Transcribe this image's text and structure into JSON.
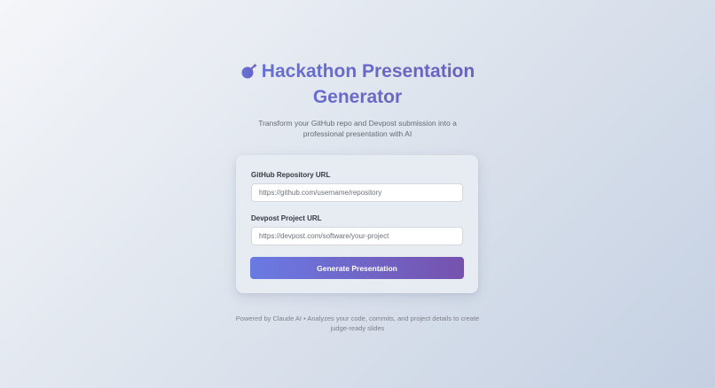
{
  "header": {
    "title_line1": "Hackathon Presentation",
    "title_line2": "Generator",
    "title_icon": "rocket-icon",
    "subtitle": "Transform your GitHub repo and Devpost submission into a professional presentation with AI"
  },
  "form": {
    "github": {
      "label": "GitHub Repository URL",
      "placeholder": "https://github.com/username/repository",
      "value": ""
    },
    "devpost": {
      "label": "Devpost Project URL",
      "placeholder": "https://devpost.com/software/your-project",
      "value": ""
    },
    "submit_label": "Generate Presentation"
  },
  "footer": {
    "text": "Powered by Claude AI • Analyzes your code, commits, and project details to create judge-ready slides"
  },
  "colors": {
    "accent_start": "#6a7ae3",
    "accent_end": "#7652ad",
    "title": "#6673d8"
  }
}
